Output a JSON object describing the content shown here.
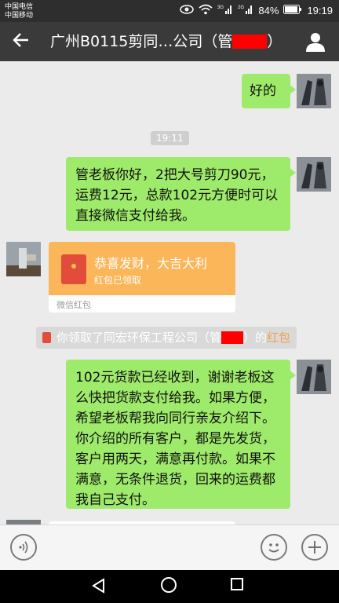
{
  "status_bar": {
    "carrier_1": "中国电信",
    "carrier_2": "中国移动",
    "battery": "84%",
    "time": "19:19",
    "icons": [
      "eye-icon",
      "wifi-icon",
      "signal-3g-icon",
      "signal-2g-icon",
      "battery-icon"
    ]
  },
  "header": {
    "back_icon": "arrow-left-icon",
    "title_start": "广州B0115剪同…公司（管",
    "title_end": "）",
    "profile_icon": "person-icon"
  },
  "chat": {
    "msg_1": "好的",
    "time_chip": "19:11",
    "msg_2": "管老板你好，2把大号剪刀90元，运费12元，总款102元方便时可以直接微信支付给我。",
    "red_packet": {
      "title": "恭喜发财，大吉大利",
      "subtitle": "红包已领取",
      "footer": "微信红包"
    },
    "system": {
      "prefix": "你领取了同宏环保工程公司（管",
      "suffix": "）的",
      "link": "红包"
    },
    "msg_3": "102元货款已经收到，谢谢老板这么快把货款支付给我。如果方便，希望老板帮我向同行亲友介绍下。你介绍的所有客户，都是先发货，客户用两天，满意再付款。如果不满意，无条件退货，回来的运费都我自己支付。"
  },
  "input_bar": {
    "voice_icon": "voice-icon",
    "emoji_icon": "emoji-icon",
    "plus_icon": "plus-icon"
  },
  "colors": {
    "bubble_green": "#9eea6a",
    "header_bg": "#3a3a3a",
    "red_packet": "#fab659",
    "link": "#f0a24a"
  }
}
